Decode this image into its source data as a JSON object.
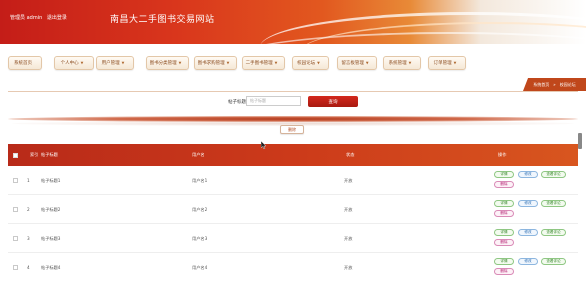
{
  "header": {
    "user_role": "管理员 admin",
    "logout": "退出登录",
    "site_title": "南昌大二手图书交易网站"
  },
  "nav": {
    "items": [
      {
        "label": "系统首页",
        "dropdown": false
      },
      {
        "label": "个人中心",
        "dropdown": true
      },
      {
        "label": "用户管理",
        "dropdown": true
      },
      {
        "label": "图书分类管理",
        "dropdown": true
      },
      {
        "label": "图书求购管理",
        "dropdown": true
      },
      {
        "label": "二手图书管理",
        "dropdown": true
      },
      {
        "label": "校园论坛",
        "dropdown": true
      },
      {
        "label": "留言板管理",
        "dropdown": true
      },
      {
        "label": "系统管理",
        "dropdown": true
      },
      {
        "label": "订单管理",
        "dropdown": true
      }
    ]
  },
  "breadcrumb": {
    "home": "系统首页",
    "sep": "»",
    "current": "校园论坛"
  },
  "search": {
    "label": "帖子标题",
    "placeholder": "帖子标题",
    "button": "查询"
  },
  "toolbar": {
    "delete": "删除"
  },
  "table": {
    "headers": {
      "select": "",
      "index": "索引",
      "title": "帖子标题",
      "username": "用户名",
      "status": "状态",
      "actions": "操作"
    },
    "rows": [
      {
        "index": "1",
        "title": "帖子标题1",
        "username": "用户名1",
        "status": "开放"
      },
      {
        "index": "2",
        "title": "帖子标题2",
        "username": "用户名2",
        "status": "开放"
      },
      {
        "index": "3",
        "title": "帖子标题3",
        "username": "用户名3",
        "status": "开放"
      },
      {
        "index": "4",
        "title": "帖子标题4",
        "username": "用户名4",
        "status": "开放"
      }
    ],
    "action_labels": {
      "detail": "详情",
      "edit": "修改",
      "review": "查看评论",
      "delete": "删除"
    }
  },
  "colors": {
    "accent": "#c41d18",
    "header_gradient_end": "#e88a37",
    "table_header": "#cc3a1a"
  }
}
